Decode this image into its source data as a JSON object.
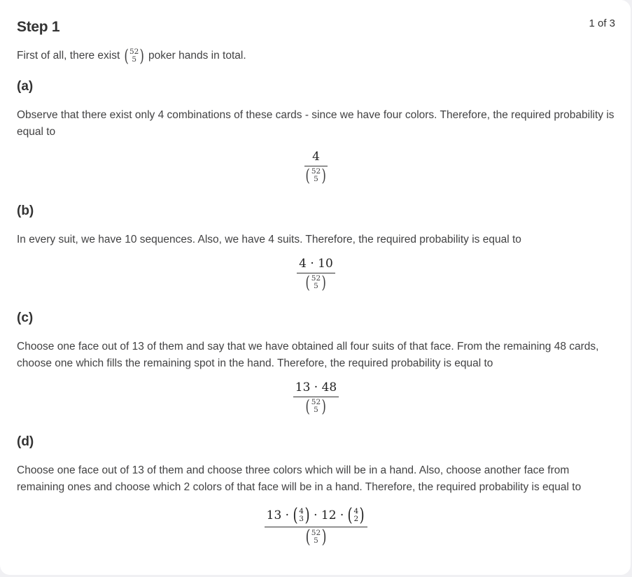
{
  "step": {
    "title": "Step 1",
    "counter": "1 of 3"
  },
  "intro": {
    "prefix": "First of all, there exist",
    "suffix": "poker hands in total.",
    "binom_top": "52",
    "binom_bottom": "5"
  },
  "parts": [
    {
      "label": "(a)",
      "text": "Observe that there exist only 4 combinations of these cards - since we have four colors. Therefore, the required probability is equal to",
      "numerator": "4"
    },
    {
      "label": "(b)",
      "text": "In every suit, we have 10 sequences. Also, we have 4 suits. Therefore, the required probability is equal to",
      "numerator": "4 · 10"
    },
    {
      "label": "(c)",
      "text": "Choose one face out of 13 of them and say that we have obtained all four suits of that face. From the remaining 48 cards, choose one which fills the remaining spot in the hand. Therefore, the required probability is equal to",
      "numerator": "13 · 48"
    },
    {
      "label": "(d)",
      "text": "Choose one face out of 13 of them and choose three colors which will be in a hand. Also, choose another face from remaining ones and choose which 2 colors of that face will be in a hand. Therefore, the required probability is equal to",
      "numerator_parts": [
        "13 ·",
        "· 12 ·"
      ],
      "numerator_binoms": [
        {
          "top": "4",
          "bottom": "3"
        },
        {
          "top": "4",
          "bottom": "2"
        }
      ]
    }
  ],
  "denominator": {
    "top": "52",
    "bottom": "5"
  }
}
